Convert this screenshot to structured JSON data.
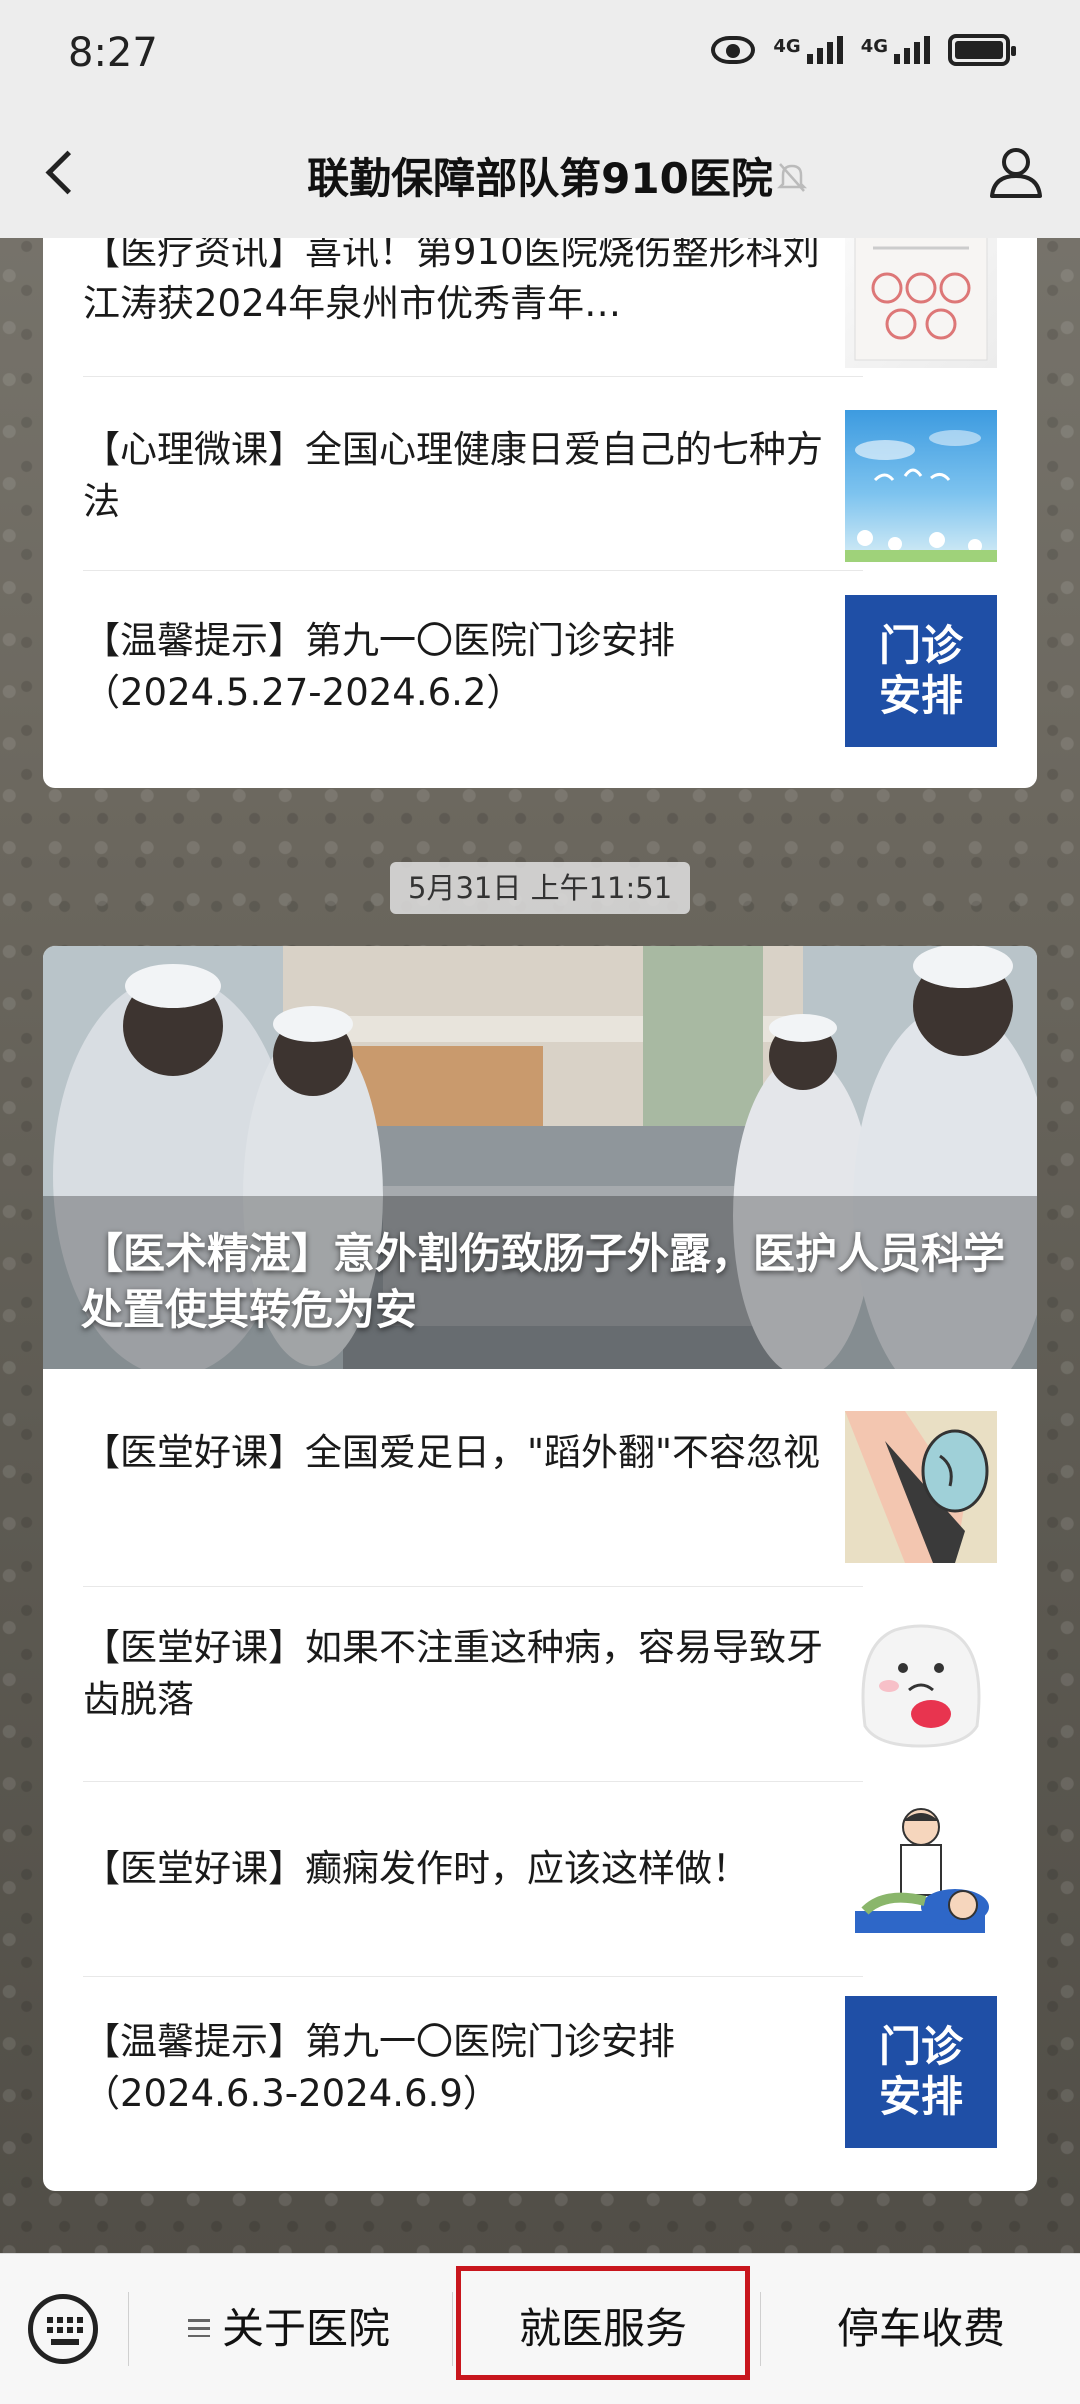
{
  "status_bar": {
    "time": "8:27",
    "network_1": "4G",
    "network_2": "4G"
  },
  "header": {
    "title": "联勤保障部队第910医院"
  },
  "card1": {
    "items": [
      {
        "text": "【医疗资讯】喜讯！第910医院烧伤整形科刘江涛获2024年泉州市优秀青年…",
        "thumb": "award-certificate-image"
      },
      {
        "text": "【心理微课】全国心理健康日爱自己的七种方法",
        "thumb": "sky-flowers-image"
      },
      {
        "text": "【温馨提示】第九一〇医院门诊安排（2024.5.27-2024.6.2）",
        "thumb": "clinic-schedule-image",
        "thumb_label_1": "门诊",
        "thumb_label_2": "安排"
      }
    ]
  },
  "timestamp": "5月31日 上午11:51",
  "card2": {
    "hero_title": "【医术精湛】意外割伤致肠子外露，医护人员科学处置使其转危为安",
    "items": [
      {
        "text": "【医堂好课】全国爱足日，\"蹈外翻\"不容忽视",
        "thumb": "foot-high-heel-image"
      },
      {
        "text": "【医堂好课】如果不注重这种病，容易导致牙齿脱落",
        "thumb": "tooth-cartoon-image"
      },
      {
        "text": "【医堂好课】癫痫发作时，应该这样做！",
        "thumb": "doctor-patient-cartoon-image"
      },
      {
        "text": "【温馨提示】第九一〇医院门诊安排（2024.6.3-2024.6.9）",
        "thumb": "clinic-schedule-image",
        "thumb_label_1": "门诊",
        "thumb_label_2": "安排"
      }
    ]
  },
  "bottom_menu": {
    "item1": "关于医院",
    "item2": "就医服务",
    "item3": "停车收费"
  },
  "colors": {
    "highlight": "#c8161d",
    "schedule_blue": "#1f4fa6"
  }
}
